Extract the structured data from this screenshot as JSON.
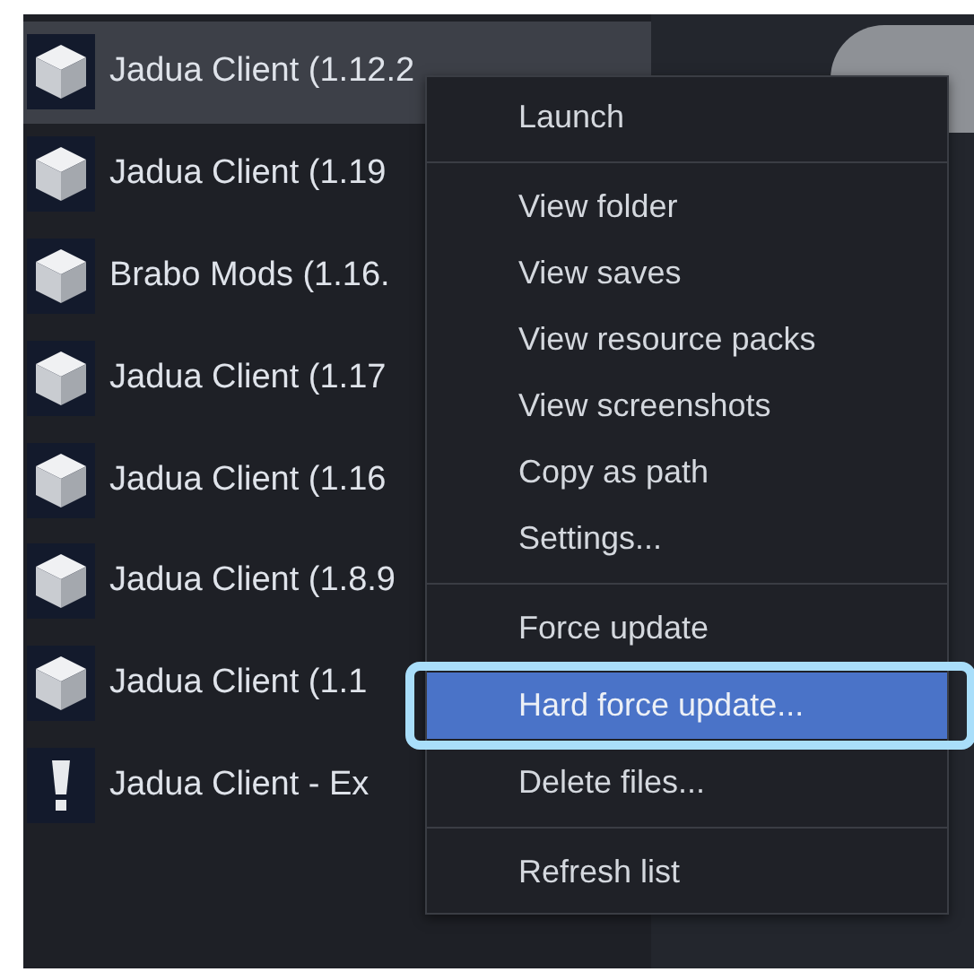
{
  "profiles": [
    {
      "name": "Jadua Client (1.12.2",
      "kind": "instance",
      "selected": true
    },
    {
      "name": "Jadua Client (1.19",
      "kind": "instance",
      "selected": false
    },
    {
      "name": "Brabo Mods (1.16.",
      "kind": "instance",
      "selected": false
    },
    {
      "name": "Jadua Client (1.17",
      "kind": "instance",
      "selected": false
    },
    {
      "name": "Jadua Client (1.16",
      "kind": "instance",
      "selected": false
    },
    {
      "name": "Jadua Client (1.8.9",
      "kind": "instance",
      "selected": false
    },
    {
      "name": "Jadua Client (1.1",
      "kind": "instance",
      "selected": false
    },
    {
      "name": "Jadua Client - Ex",
      "kind": "error",
      "selected": false
    }
  ],
  "context_menu": {
    "items": [
      {
        "kind": "item",
        "label": "Launch",
        "selected": false
      },
      {
        "kind": "separator"
      },
      {
        "kind": "item",
        "label": "View folder",
        "selected": false
      },
      {
        "kind": "item",
        "label": "View saves",
        "selected": false
      },
      {
        "kind": "item",
        "label": "View resource packs",
        "selected": false
      },
      {
        "kind": "item",
        "label": "View screenshots",
        "selected": false
      },
      {
        "kind": "item",
        "label": "Copy as path",
        "selected": false
      },
      {
        "kind": "item",
        "label": "Settings...",
        "selected": false
      },
      {
        "kind": "separator"
      },
      {
        "kind": "item",
        "label": "Force update",
        "selected": false
      },
      {
        "kind": "item",
        "label": "Hard force update...",
        "selected": true
      },
      {
        "kind": "item",
        "label": "Delete files...",
        "selected": false
      },
      {
        "kind": "separator"
      },
      {
        "kind": "item",
        "label": "Refresh list",
        "selected": false
      }
    ]
  }
}
